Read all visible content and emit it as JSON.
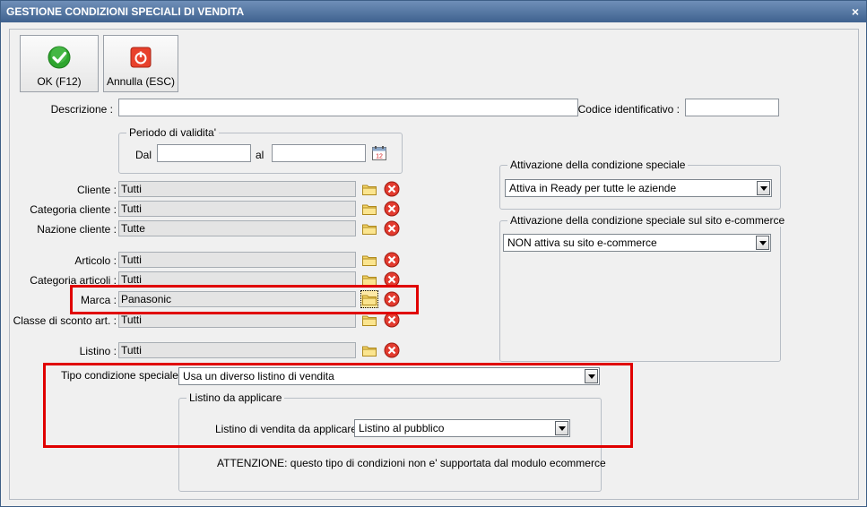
{
  "window": {
    "title": "GESTIONE CONDIZIONI SPECIALI DI VENDITA",
    "close_glyph": "×"
  },
  "toolbar": {
    "ok_label": "OK (F12)",
    "ok_icon": "green-check-icon",
    "cancel_label": "Annulla (ESC)",
    "cancel_icon": "power-off-icon"
  },
  "form": {
    "descrizione_label": "Descrizione :",
    "descrizione_value": "",
    "codice_label": "Codice identificativo :",
    "codice_value": "",
    "periodo_caption": "Periodo di validita'",
    "dal_label": "Dal",
    "dal_value": "",
    "al_label": "al",
    "al_value": ""
  },
  "filters": [
    {
      "label": "Cliente :",
      "value": "Tutti"
    },
    {
      "label": "Categoria cliente :",
      "value": "Tutti"
    },
    {
      "label": "Nazione cliente :",
      "value": "Tutte"
    },
    {
      "label": "Articolo :",
      "value": "Tutti"
    },
    {
      "label": "Categoria articoli :",
      "value": "Tutti"
    },
    {
      "label": "Marca :",
      "value": "Panasonic"
    },
    {
      "label": "Classe di sconto art. :",
      "value": "Tutti"
    },
    {
      "label": "Listino :",
      "value": "Tutti"
    }
  ],
  "activation": {
    "caption": "Attivazione della condizione speciale",
    "value": "Attiva in Ready per tutte le aziende"
  },
  "ecommerce": {
    "caption": "Attivazione della condizione speciale sul sito e-commerce",
    "value": "NON attiva su sito e-commerce"
  },
  "tipo": {
    "label": "Tipo condizione speciale :",
    "value": "Usa un diverso listino di vendita"
  },
  "listino": {
    "caption": "Listino da applicare",
    "label": "Listino di vendita da applicare :",
    "value": "Listino al pubblico",
    "warning": "ATTENZIONE: questo tipo di condizioni non e' supportata dal modulo ecommerce"
  },
  "colors": {
    "highlight_border": "#e00000",
    "title_bar": "#4f73a1"
  }
}
